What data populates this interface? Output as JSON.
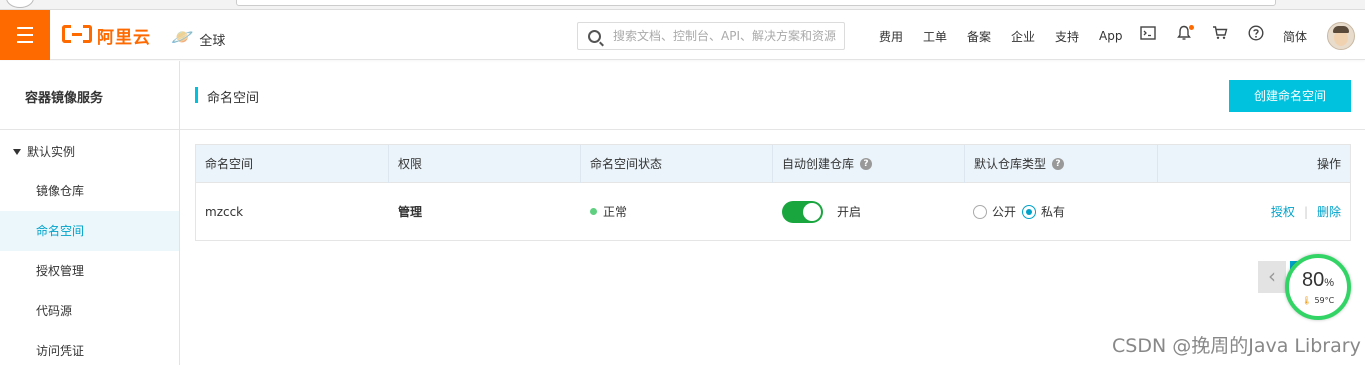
{
  "topnav": {
    "logo_text": "阿里云",
    "region": "全球",
    "search_placeholder": "搜索文档、控制台、API、解决方案和资源",
    "links": [
      "费用",
      "工单",
      "备案",
      "企业",
      "支持",
      "App"
    ],
    "lang": "简体"
  },
  "sidebar": {
    "title": "容器镜像服务",
    "group": "默认实例",
    "items": [
      "镜像仓库",
      "命名空间",
      "授权管理",
      "代码源",
      "访问凭证"
    ],
    "active_index": 1
  },
  "main": {
    "page_title": "命名空间",
    "create_button": "创建命名空间",
    "columns": [
      "命名空间",
      "权限",
      "命名空间状态",
      "自动创建仓库",
      "默认仓库类型",
      "操作"
    ],
    "rows": [
      {
        "namespace": "mzcck",
        "permission": "管理",
        "status": "正常",
        "auto_create": "开启",
        "repo_type_options": [
          "公开",
          "私有"
        ],
        "repo_type_selected": "私有",
        "actions": [
          "授权",
          "删除"
        ]
      }
    ]
  },
  "widgets": {
    "gauge_percent": "80",
    "gauge_unit": "%",
    "gauge_temp": "59°C",
    "watermark": "CSDN @挽周的Java Library"
  },
  "colors": {
    "brand_orange": "#ff6a00",
    "accent_blue": "#00c1de",
    "link_blue": "#00a2ca",
    "toggle_green": "#1aa63f"
  }
}
